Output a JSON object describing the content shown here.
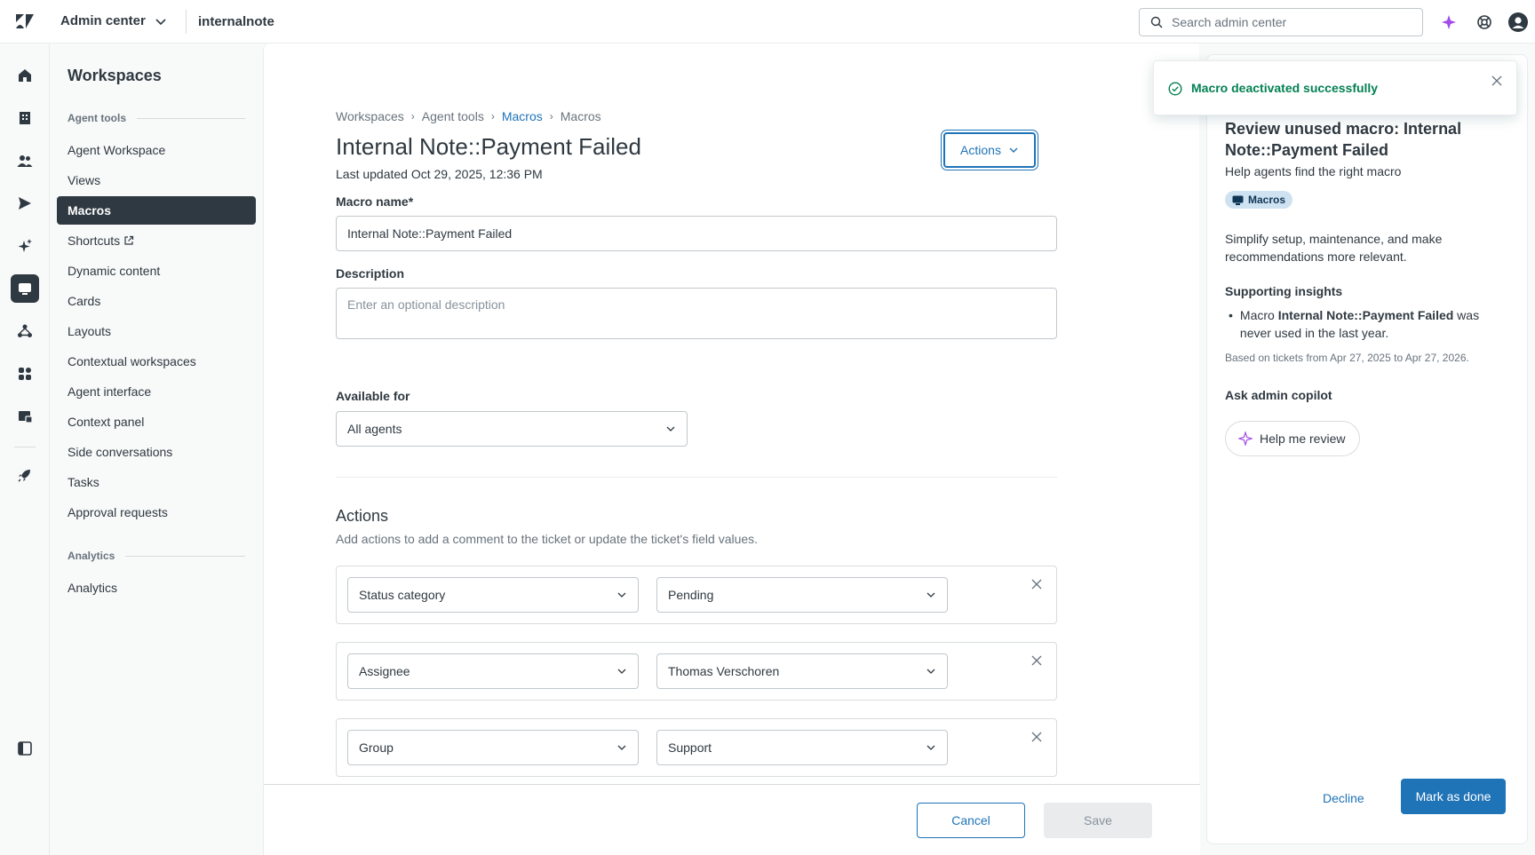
{
  "topbar": {
    "product": "Admin center",
    "account": "internalnote",
    "search_placeholder": "Search admin center"
  },
  "nav": {
    "title": "Workspaces",
    "section1": "Agent tools",
    "items": [
      {
        "label": "Agent Workspace"
      },
      {
        "label": "Views"
      },
      {
        "label": "Macros"
      },
      {
        "label": "Shortcuts"
      },
      {
        "label": "Dynamic content"
      },
      {
        "label": "Cards"
      },
      {
        "label": "Layouts"
      },
      {
        "label": "Contextual workspaces"
      },
      {
        "label": "Agent interface"
      },
      {
        "label": "Context panel"
      },
      {
        "label": "Side conversations"
      },
      {
        "label": "Tasks"
      },
      {
        "label": "Approval requests"
      }
    ],
    "section2": "Analytics",
    "items2": [
      {
        "label": "Analytics"
      }
    ]
  },
  "main": {
    "breadcrumb": [
      "Workspaces",
      "Agent tools",
      "Macros",
      "Macros"
    ],
    "title": "Internal Note::Payment Failed",
    "last_updated": "Last updated Oct 29, 2025, 12:36 PM",
    "actions_label": "Actions",
    "macro_name_label": "Macro name*",
    "macro_name_value": "Internal Note::Payment Failed",
    "description_label": "Description",
    "description_placeholder": "Enter an optional description",
    "available_label": "Available for",
    "available_value": "All agents",
    "actions_title": "Actions",
    "actions_desc": "Add actions to add a comment to the ticket or update the ticket's field values.",
    "action_rows": [
      {
        "field": "Status category",
        "value": "Pending"
      },
      {
        "field": "Assignee",
        "value": "Thomas Verschoren"
      },
      {
        "field": "Group",
        "value": "Support"
      }
    ],
    "cancel_label": "Cancel",
    "save_label": "Save"
  },
  "panel": {
    "title": "Review unused macro: Internal Note::Payment Failed",
    "subtitle": "Help agents find the right macro",
    "tag": "Macros",
    "body": "Simplify setup, maintenance, and make recommendations more relevant.",
    "insights_heading": "Supporting insights",
    "insight_prefix": "Macro ",
    "insight_bold": "Internal Note::Payment Failed",
    "insight_suffix": " was never used in the last year.",
    "note": "Based on tickets from Apr 27, 2025 to Apr 27, 2026.",
    "copilot_heading": "Ask admin copilot",
    "copilot_button": "Help me review",
    "decline_label": "Decline",
    "done_label": "Mark as done"
  },
  "toast": {
    "message": "Macro deactivated successfully"
  },
  "colors": {
    "accent": "#1f73b7",
    "success": "#038153",
    "nav_active": "#2f3941",
    "copilot": "#a34be6"
  }
}
